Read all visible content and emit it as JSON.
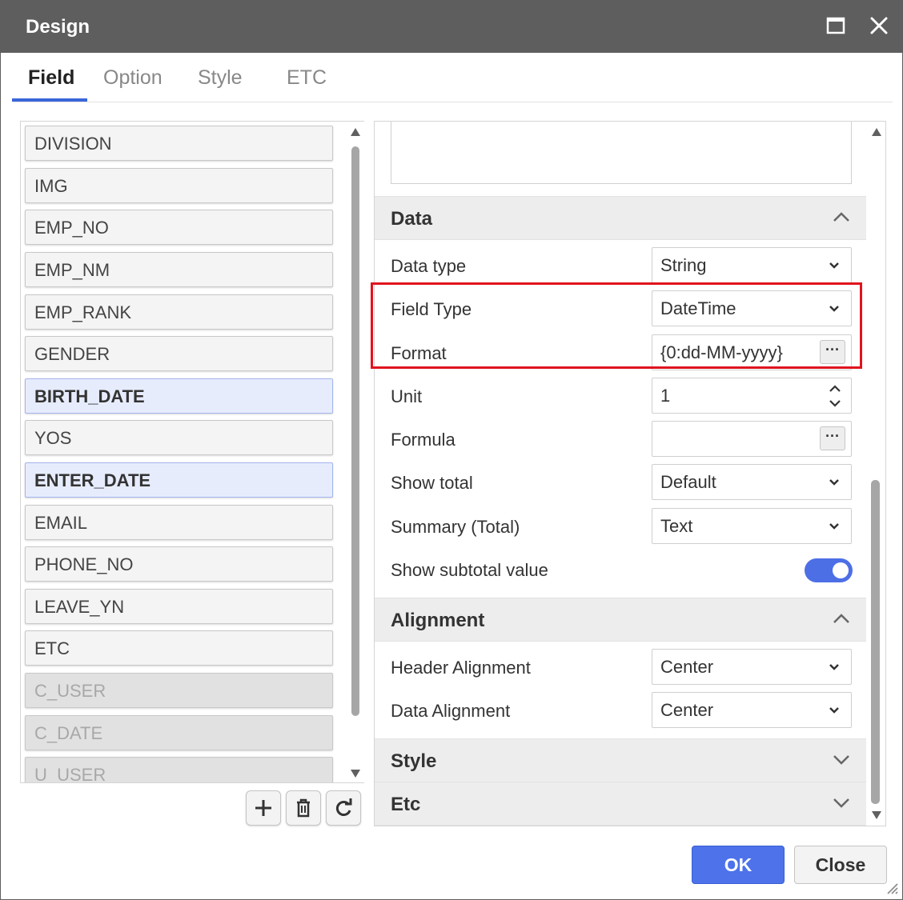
{
  "window": {
    "title": "Design"
  },
  "tabs": [
    {
      "label": "Field"
    },
    {
      "label": "Option"
    },
    {
      "label": "Style"
    },
    {
      "label": "ETC"
    }
  ],
  "fields": [
    {
      "label": "DIVISION"
    },
    {
      "label": "IMG"
    },
    {
      "label": "EMP_NO"
    },
    {
      "label": "EMP_NM"
    },
    {
      "label": "EMP_RANK"
    },
    {
      "label": "GENDER"
    },
    {
      "label": "BIRTH_DATE"
    },
    {
      "label": "YOS"
    },
    {
      "label": "ENTER_DATE"
    },
    {
      "label": "EMAIL"
    },
    {
      "label": "PHONE_NO"
    },
    {
      "label": "LEAVE_YN"
    },
    {
      "label": "ETC"
    },
    {
      "label": "C_USER"
    },
    {
      "label": "C_DATE"
    },
    {
      "label": "U_USER"
    }
  ],
  "sections": {
    "data": {
      "title": "Data",
      "data_type": {
        "label": "Data type",
        "value": "String"
      },
      "field_type": {
        "label": "Field Type",
        "value": "DateTime"
      },
      "format": {
        "label": "Format",
        "value": "{0:dd-MM-yyyy}"
      },
      "unit": {
        "label": "Unit",
        "value": "1"
      },
      "formula": {
        "label": "Formula",
        "value": ""
      },
      "show_total": {
        "label": "Show total",
        "value": "Default"
      },
      "summary_total": {
        "label": "Summary (Total)",
        "value": "Text"
      },
      "show_subtotal": {
        "label": "Show subtotal value",
        "on": true
      }
    },
    "alignment": {
      "title": "Alignment",
      "header_alignment": {
        "label": "Header Alignment",
        "value": "Center"
      },
      "data_alignment": {
        "label": "Data Alignment",
        "value": "Center"
      }
    },
    "style": {
      "title": "Style"
    },
    "etc": {
      "title": "Etc"
    }
  },
  "buttons": {
    "ok": "OK",
    "close": "Close",
    "ellipsis": "···"
  },
  "colors": {
    "accent": "#4d72ea",
    "highlight": "#e0141e",
    "titlebar": "#5e5e5e"
  }
}
